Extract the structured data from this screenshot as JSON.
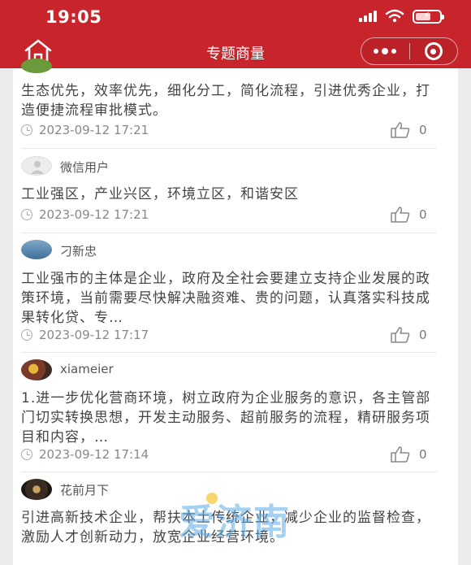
{
  "status_bar": {
    "time": "19:05"
  },
  "nav": {
    "title": "专题商量"
  },
  "comments": [
    {
      "username": "",
      "content": "生态优先，效率优先，细化分工，简化流程，引进优秀企业，打造便捷流程审批模式。",
      "time": "2023-09-12 17:21",
      "likes": "0"
    },
    {
      "username": "微信用户",
      "content": "工业强区，产业兴区，环境立区，和谐安区",
      "time": "2023-09-12 17:21",
      "likes": "0"
    },
    {
      "username": "刁新忠",
      "content": "工业强市的主体是企业，政府及全社会要建立支持企业发展的政策环境，当前需要尽快解决融资难、贵的问题，认真落实科技成果转化贷、专…",
      "time": "2023-09-12 17:17",
      "likes": "0"
    },
    {
      "username": "xiameier",
      "content": "1.进一步优化营商环境，树立政府为企业服务的意识，各主管部门切实转换思想，开发主动服务、超前服务的流程，精研服务项目和内容，…",
      "time": "2023-09-12 17:14",
      "likes": "0"
    },
    {
      "username": "花前月下",
      "content": "引进高新技术企业，帮扶本土传统企业，减少企业的监督检查，激励人才创新动力，放宽企业经营环境。",
      "time": "",
      "likes": ""
    }
  ],
  "watermark": {
    "text": "爱济南"
  }
}
